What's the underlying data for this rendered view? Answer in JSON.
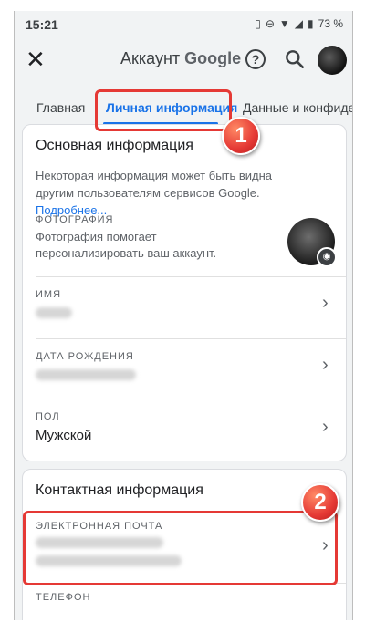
{
  "status_bar": {
    "time": "15:21",
    "battery": "73 %"
  },
  "app_bar": {
    "title_prefix": "Аккаунт",
    "title_brand": "Google"
  },
  "tabs": [
    {
      "label": "Главная"
    },
    {
      "label": "Личная информация"
    },
    {
      "label": "Данные и конфиде"
    }
  ],
  "annotations": {
    "badge1": "1",
    "badge2": "2"
  },
  "basic_info": {
    "title": "Основная информация",
    "description": "Некоторая информация может быть видна другим пользователям сервисов Google.",
    "more_link": "Подробнее...",
    "photo": {
      "label": "ФОТОГРАФИЯ",
      "hint": "Фотография помогает персонализировать ваш аккаунт."
    },
    "name": {
      "label": "ИМЯ"
    },
    "birthday": {
      "label": "ДАТА РОЖДЕНИЯ"
    },
    "gender": {
      "label": "ПОЛ",
      "value": "Мужской"
    }
  },
  "contact_info": {
    "title": "Контактная информация",
    "email": {
      "label": "ЭЛЕКТРОННАЯ ПОЧТА"
    },
    "phone": {
      "label": "ТЕЛЕФОН"
    }
  },
  "colors": {
    "accent": "#1a73e8",
    "highlight": "#e53935"
  }
}
